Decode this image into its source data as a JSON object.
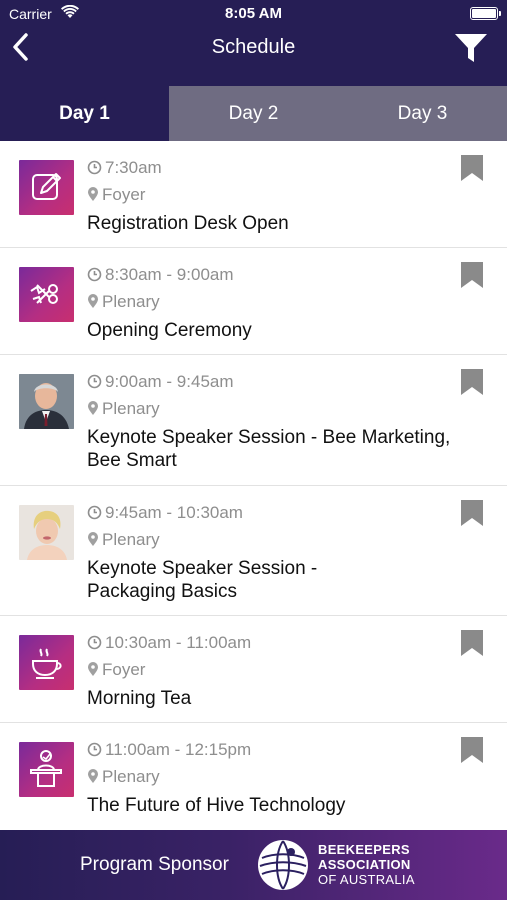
{
  "status_bar": {
    "carrier": "Carrier",
    "time": "8:05 AM"
  },
  "nav": {
    "title": "Schedule"
  },
  "tabs": [
    {
      "label": "Day 1",
      "selected": true
    },
    {
      "label": "Day 2",
      "selected": false
    },
    {
      "label": "Day 3",
      "selected": false
    }
  ],
  "sessions": [
    {
      "time": "7:30am",
      "location": "Foyer",
      "title_lines": [
        "Registration Desk Open"
      ],
      "icon": "edit-icon"
    },
    {
      "time": "8:30am - 9:00am",
      "location": "Plenary",
      "title_lines": [
        "Opening Ceremony"
      ],
      "icon": "ribbon-cut-icon"
    },
    {
      "time": "9:00am - 9:45am",
      "location": "Plenary",
      "title_lines": [
        "Keynote Speaker Session - Bee Marketing,",
        "Bee Smart"
      ],
      "icon": "speaker-photo-man"
    },
    {
      "time": "9:45am - 10:30am",
      "location": "Plenary",
      "title_lines": [
        "Keynote Speaker Session -",
        "Packaging Basics"
      ],
      "icon": "speaker-photo-woman"
    },
    {
      "time": "10:30am - 11:00am",
      "location": "Foyer",
      "title_lines": [
        "Morning Tea"
      ],
      "icon": "teacup-icon"
    },
    {
      "time": "11:00am - 12:15pm",
      "location": "Plenary",
      "title_lines": [
        "The Future of Hive Technology"
      ],
      "icon": "podium-speaker-icon"
    }
  ],
  "footer": {
    "label": "Program Sponsor",
    "org_line1": "BEEKEEPERS",
    "org_line2": "ASSOCIATION",
    "org_line3": "OF AUSTRALIA"
  },
  "colors": {
    "header_bg": "#261e55",
    "tab_inactive_bg": "#6f6c82",
    "meta_text": "#8e8e8e",
    "thumb_gradient_start": "#7a2a9a",
    "thumb_gradient_end": "#c82f6f"
  }
}
